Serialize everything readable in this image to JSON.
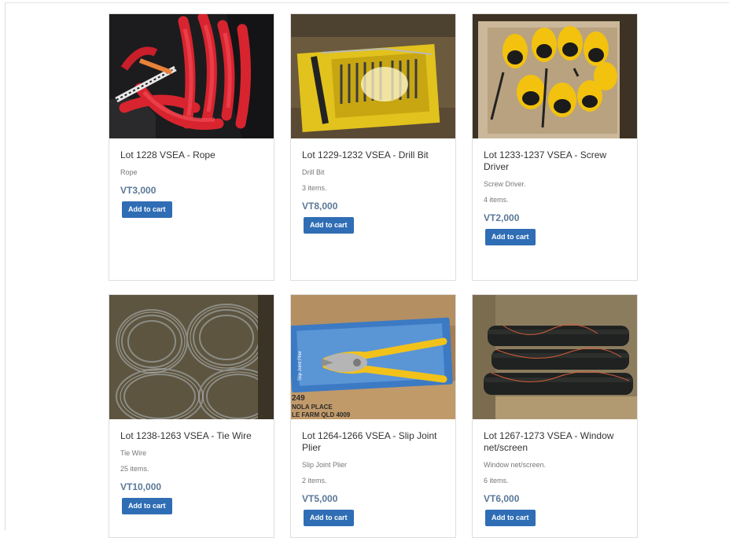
{
  "products": [
    {
      "title": "Lot 1228 VSEA - Rope",
      "description": "Rope",
      "items": "",
      "price": "VT3,000",
      "button": "Add to cart",
      "image_icon": "rope-photo"
    },
    {
      "title": "Lot 1229-1232 VSEA - Drill Bit",
      "description": "Drill Bit",
      "items": "3 items.",
      "price": "VT8,000",
      "button": "Add to cart",
      "image_icon": "drill-bit-photo"
    },
    {
      "title": "Lot 1233-1237 VSEA - Screw Driver",
      "description": "Screw Driver.",
      "items": "4 items.",
      "price": "VT2,000",
      "button": "Add to cart",
      "image_icon": "screwdriver-photo"
    },
    {
      "title": "Lot 1238-1263 VSEA - Tie Wire",
      "description": "Tie Wire",
      "items": "25 items.",
      "price": "VT10,000",
      "button": "Add to cart",
      "image_icon": "tie-wire-photo"
    },
    {
      "title": "Lot 1264-1266 VSEA - Slip Joint Plier",
      "description": "Slip Joint Plier",
      "items": "2 items.",
      "price": "VT5,000",
      "button": "Add to cart",
      "image_icon": "plier-photo"
    },
    {
      "title": "Lot 1267-1273 VSEA - Window net/screen",
      "description": "Window net/screen.",
      "items": "6 items.",
      "price": "VT6,000",
      "button": "Add to cart",
      "image_icon": "window-net-photo"
    }
  ],
  "image_text": {
    "plier_package": "Slip Joint Plier",
    "box_line1": "NOLA PLACE",
    "box_line2": "LE FARM QLD 4009",
    "box_number": "249"
  },
  "colors": {
    "button": "#2f6db5",
    "price": "#5a7898"
  }
}
